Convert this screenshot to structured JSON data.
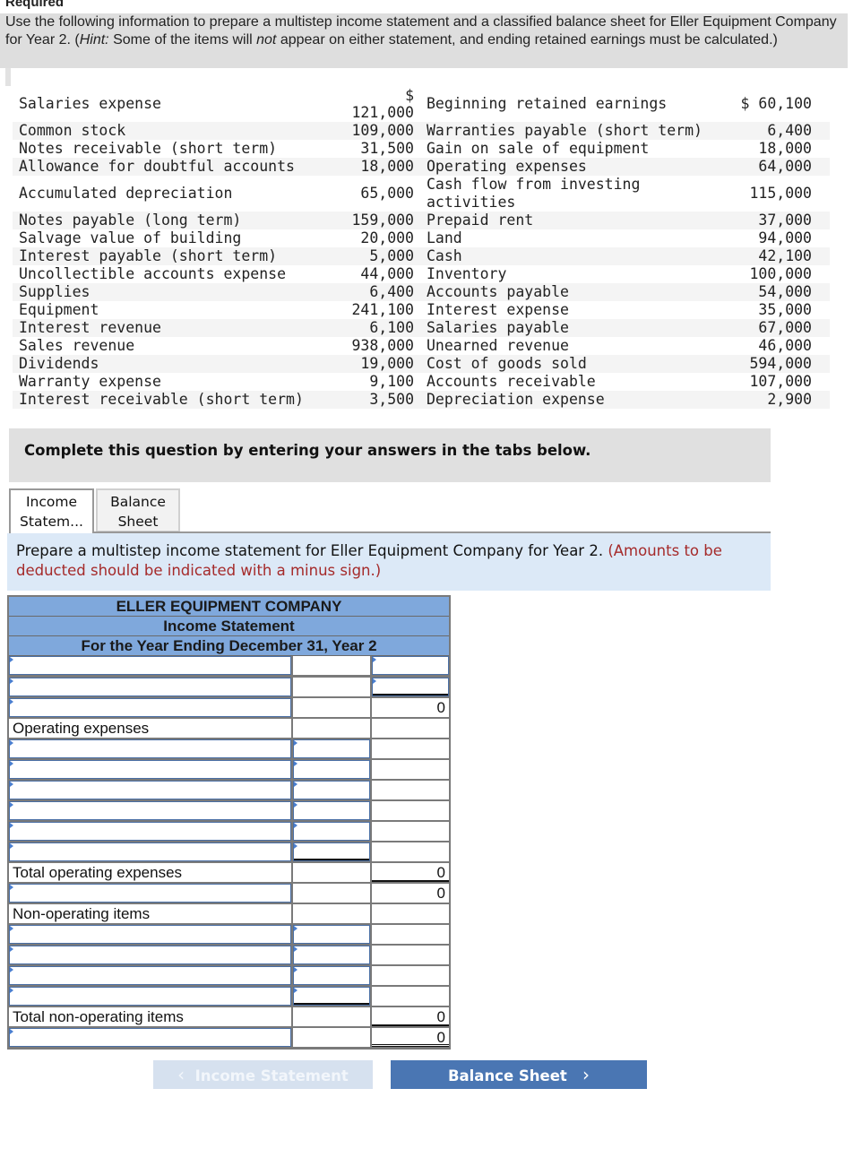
{
  "header": {
    "required_label": "Required",
    "instructions_pre": "Use the following information to prepare a multistep income statement and a classified balance sheet for Eller Equipment Company for Year 2. (",
    "instructions_hint": "Hint:",
    "instructions_mid": " Some of the items will ",
    "instructions_not": "not",
    "instructions_post": " appear on either statement, and ending retained earnings must be calculated.)"
  },
  "accounts": {
    "rows": [
      {
        "left_name": "Salaries expense",
        "left_value": "121,000",
        "left_currency": "$",
        "right_name": "Beginning retained earnings",
        "right_value": "$ 60,100"
      },
      {
        "left_name": "Common stock",
        "left_value": "109,000",
        "right_name": "Warranties payable (short term)",
        "right_value": "6,400"
      },
      {
        "left_name": "Notes receivable (short term)",
        "left_value": "31,500",
        "right_name": "Gain on sale of equipment",
        "right_value": "18,000"
      },
      {
        "left_name": "Allowance for doubtful accounts",
        "left_value": "18,000",
        "right_name": "Operating expenses",
        "right_value": "64,000"
      },
      {
        "left_name": "Accumulated depreciation",
        "left_value": "65,000",
        "right_name": "Cash flow from investing activities",
        "right_value": "115,000"
      },
      {
        "left_name": "Notes payable (long term)",
        "left_value": "159,000",
        "right_name": "Prepaid rent",
        "right_value": "37,000"
      },
      {
        "left_name": "Salvage value of building",
        "left_value": "20,000",
        "right_name": "Land",
        "right_value": "94,000"
      },
      {
        "left_name": "Interest payable (short term)",
        "left_value": "5,000",
        "right_name": "Cash",
        "right_value": "42,100"
      },
      {
        "left_name": "Uncollectible accounts expense",
        "left_value": "44,000",
        "right_name": "Inventory",
        "right_value": "100,000"
      },
      {
        "left_name": "Supplies",
        "left_value": "6,400",
        "right_name": "Accounts payable",
        "right_value": "54,000"
      },
      {
        "left_name": "Equipment",
        "left_value": "241,100",
        "right_name": "Interest expense",
        "right_value": "35,000"
      },
      {
        "left_name": "Interest revenue",
        "left_value": "6,100",
        "right_name": "Salaries payable",
        "right_value": "67,000"
      },
      {
        "left_name": "Sales revenue",
        "left_value": "938,000",
        "right_name": "Unearned revenue",
        "right_value": "46,000"
      },
      {
        "left_name": "Dividends",
        "left_value": "19,000",
        "right_name": "Cost of goods sold",
        "right_value": "594,000"
      },
      {
        "left_name": "Warranty expense",
        "left_value": "9,100",
        "right_name": "Accounts receivable",
        "right_value": "107,000"
      },
      {
        "left_name": "Interest receivable (short term)",
        "left_value": "3,500",
        "right_name": "Depreciation expense",
        "right_value": "2,900"
      }
    ]
  },
  "prompt": "Complete this question by entering your answers in the tabs below.",
  "tabs": [
    {
      "label_line1": "Income",
      "label_line2": "Statem...",
      "active": true
    },
    {
      "label_line1": "Balance",
      "label_line2": "Sheet",
      "active": false
    }
  ],
  "direction": {
    "text": "Prepare a multistep income statement for Eller Equipment Company for Year 2.",
    "note": "(Amounts to be deducted should be indicated with a minus sign.)"
  },
  "statement": {
    "company": "ELLER EQUIPMENT COMPANY",
    "title": "Income Statement",
    "period": "For the Year Ending December 31, Year 2",
    "rows": [
      {
        "label": "",
        "label_input": true,
        "col2": "",
        "col2_input": false,
        "col3": "",
        "col3_input": true
      },
      {
        "label": "",
        "label_input": true,
        "col2": "",
        "col2_input": false,
        "col3": "",
        "col3_input": true,
        "col3_underline": true
      },
      {
        "label": "",
        "label_input": true,
        "col2": "",
        "col2_input": false,
        "col3": "0",
        "col3_input": false
      },
      {
        "label": "Operating expenses",
        "label_input": false,
        "col2": "",
        "col2_input": false,
        "col3": "",
        "col3_input": false
      },
      {
        "label": "",
        "label_input": true,
        "col2": "",
        "col2_input": true,
        "col3": "",
        "col3_input": false
      },
      {
        "label": "",
        "label_input": true,
        "col2": "",
        "col2_input": true,
        "col3": "",
        "col3_input": false
      },
      {
        "label": "",
        "label_input": true,
        "col2": "",
        "col2_input": true,
        "col3": "",
        "col3_input": false
      },
      {
        "label": "",
        "label_input": true,
        "col2": "",
        "col2_input": true,
        "col3": "",
        "col3_input": false
      },
      {
        "label": "",
        "label_input": true,
        "col2": "",
        "col2_input": true,
        "col3": "",
        "col3_input": false
      },
      {
        "label": "",
        "label_input": true,
        "col2": "",
        "col2_input": true,
        "col3": "",
        "col3_input": false,
        "col2_underline": true
      },
      {
        "label": "Total operating expenses",
        "label_input": false,
        "col2": "",
        "col2_input": false,
        "col3": "0",
        "col3_input": false,
        "col3_underline": true
      },
      {
        "label": "",
        "label_input": true,
        "col2": "",
        "col2_input": false,
        "col3": "0",
        "col3_input": false
      },
      {
        "label": "Non-operating items",
        "label_input": false,
        "col2": "",
        "col2_input": false,
        "col3": "",
        "col3_input": false
      },
      {
        "label": "",
        "label_input": true,
        "col2": "",
        "col2_input": true,
        "col3": "",
        "col3_input": false
      },
      {
        "label": "",
        "label_input": true,
        "col2": "",
        "col2_input": true,
        "col3": "",
        "col3_input": false
      },
      {
        "label": "",
        "label_input": true,
        "col2": "",
        "col2_input": true,
        "col3": "",
        "col3_input": false
      },
      {
        "label": "",
        "label_input": true,
        "col2": "",
        "col2_input": true,
        "col3": "",
        "col3_input": false,
        "col2_underline": true
      },
      {
        "label": "Total non-operating items",
        "label_input": false,
        "col2": "",
        "col2_input": false,
        "col3": "0",
        "col3_input": false,
        "col3_underline": true
      },
      {
        "label": "",
        "label_input": true,
        "col2": "",
        "col2_input": false,
        "col3": "0",
        "col3_input": false,
        "col3_double": true
      }
    ]
  },
  "navigation": {
    "prev_label": "Income Statement",
    "next_label": "Balance Sheet",
    "prev_icon": "chevron-left-icon",
    "next_icon": "chevron-right-icon"
  }
}
